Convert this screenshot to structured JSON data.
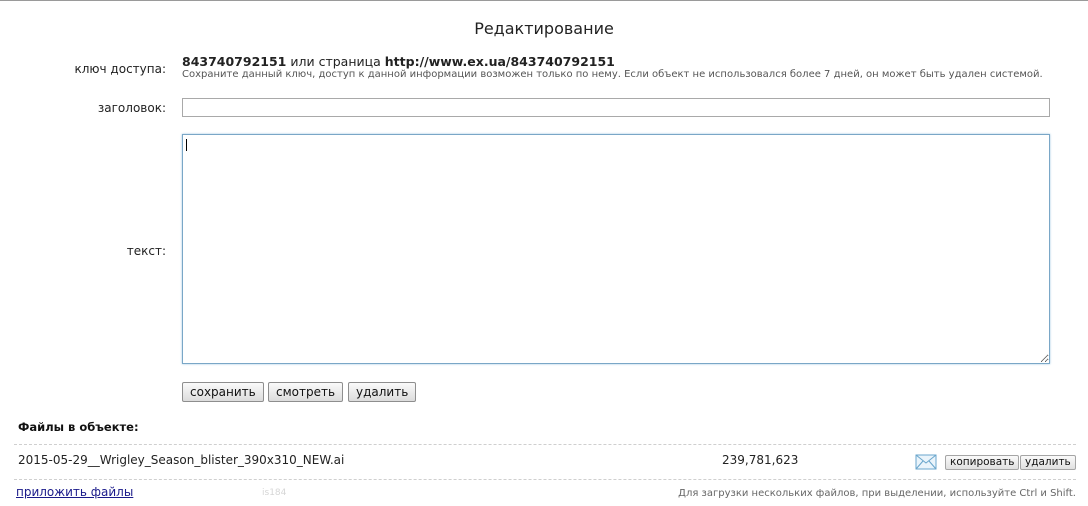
{
  "page": {
    "title": "Редактирование"
  },
  "form": {
    "access_key_label": "ключ доступа:",
    "access_key": "843740792151",
    "access_or": "или страница",
    "access_url": "http://www.ex.ua/843740792151",
    "access_note": "Сохраните данный ключ, доступ к данной информации возможен только по нему. Если объект не использовался более 7 дней, он может быть удален системой.",
    "title_label": "заголовок:",
    "title_value": "",
    "text_label": "текст:",
    "text_value": ""
  },
  "actions": {
    "save_label": "сохранить",
    "view_label": "смотреть",
    "delete_label": "удалить"
  },
  "files": {
    "heading": "Файлы в объекте:",
    "items": [
      {
        "name": "2015-05-29__Wrigley_Season_blister_390x310_NEW.ai",
        "size": "239,781,623",
        "icon": "mail-icon",
        "copy_label": "копировать",
        "delete_label": "удалить"
      }
    ],
    "attach_label": "приложить файлы",
    "faint_code": "is184",
    "hint": "Для загрузки нескольких файлов, при выделении, используйте Ctrl и Shift."
  }
}
